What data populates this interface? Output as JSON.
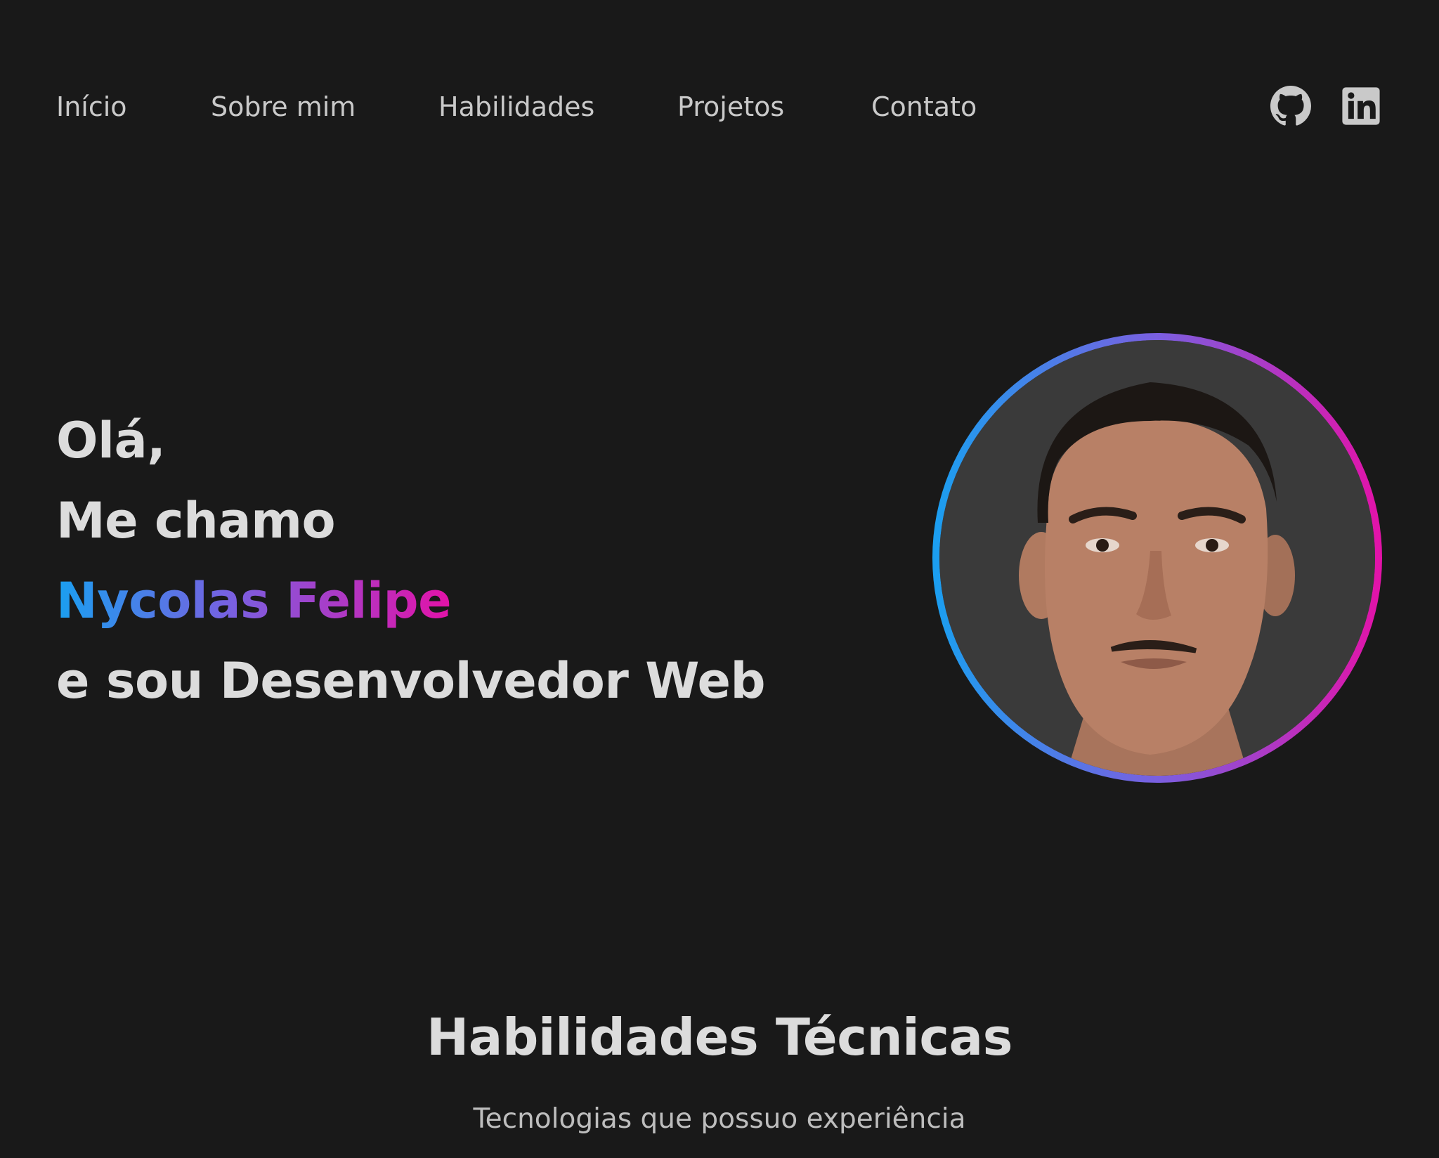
{
  "nav": {
    "items": [
      {
        "label": "Início"
      },
      {
        "label": "Sobre mim"
      },
      {
        "label": "Habilidades"
      },
      {
        "label": "Projetos"
      },
      {
        "label": "Contato"
      }
    ]
  },
  "socials": {
    "github_icon": "github-icon",
    "linkedin_icon": "linkedin-icon"
  },
  "hero": {
    "line1": "Olá,",
    "line2": "Me chamo",
    "name": "Nycolas Felipe",
    "line4": "e sou Desenvolvedor Web"
  },
  "skills": {
    "title": "Habilidades Técnicas",
    "subtitle": "Tecnologias que possuo experiência"
  },
  "colors": {
    "background": "#191919",
    "text": "#dcdcdc",
    "gradient_start": "#1a9ff0",
    "gradient_mid": "#7a5fe0",
    "gradient_end": "#e312a8"
  }
}
